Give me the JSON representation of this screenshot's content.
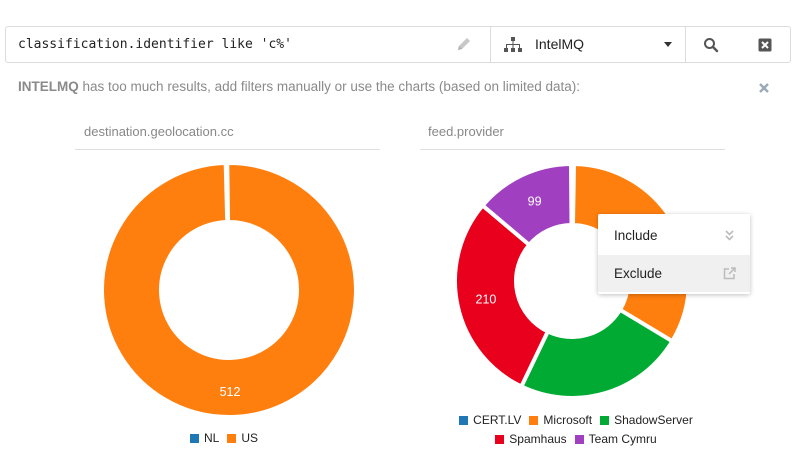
{
  "search": {
    "query": "classification.identifier like 'c%'",
    "source": "IntelMQ",
    "icons": [
      "pencil-icon",
      "sitemap-icon",
      "chevron-down-icon",
      "search-icon",
      "clear-icon"
    ]
  },
  "notice": {
    "source_name": "INTELMQ",
    "message": "has too much results, add filters manually or use the charts (based on limited data):"
  },
  "charts": [
    {
      "title": "destination.geolocation.cc"
    },
    {
      "title": "feed.provider"
    }
  ],
  "chart_data": [
    {
      "type": "pie",
      "categories": [
        "NL",
        "US"
      ],
      "values": [
        1,
        512
      ],
      "colors": [
        "#1f77b4",
        "#ff7f0e"
      ],
      "data_labels": [
        "",
        "512"
      ],
      "legend": "bottom"
    },
    {
      "type": "pie",
      "categories": [
        "CERT.LV",
        "Microsoft",
        "ShadowServer",
        "Spamhaus",
        "Team Cymru"
      ],
      "values": [
        3,
        241,
        170,
        210,
        99
      ],
      "colors": [
        "#1f77b4",
        "#ff7f0e",
        "#00aa33",
        "#e8001c",
        "#a040c0"
      ],
      "data_labels": [
        "",
        "241",
        "",
        "210",
        "99"
      ],
      "legend": "bottom"
    }
  ],
  "context_menu": {
    "items": [
      {
        "label": "Include",
        "icon": "double-chevron-down-icon"
      },
      {
        "label": "Exclude",
        "icon": "external-link-icon"
      }
    ]
  }
}
